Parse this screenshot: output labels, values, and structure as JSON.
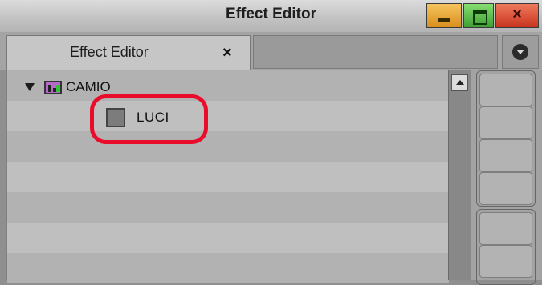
{
  "window": {
    "title": "Effect Editor",
    "buttons": {
      "minimize": "minimize",
      "maximize": "maximize",
      "close": "×"
    }
  },
  "tabs": [
    {
      "label": "Effect Editor",
      "close_symbol": "×"
    }
  ],
  "tree": {
    "root": {
      "label": "CAMIO",
      "expanded": true,
      "icon": "track-icon"
    },
    "children": [
      {
        "label": "LUCI",
        "checked": false
      }
    ]
  },
  "highlight_color": "#ea0c2b",
  "colors": {
    "minimize": "#e9a43a",
    "maximize": "#58bb47",
    "close": "#d94a32"
  }
}
